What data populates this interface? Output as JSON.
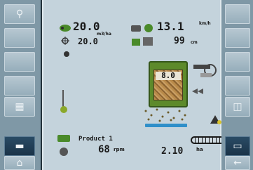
{
  "seed_rate": {
    "value": "20.0",
    "target": "20.0",
    "unit": "m3/ha"
  },
  "speed": {
    "value": "13.1",
    "unit": "km/h"
  },
  "depth": {
    "value": "99",
    "unit": "cm"
  },
  "hopper": {
    "value": "8.0"
  },
  "product": {
    "name": "Product 1",
    "rpm_value": "68",
    "rpm_unit": "rpm"
  },
  "area": {
    "value": "2.10",
    "unit": "ha"
  },
  "icons": {
    "left_top": "magnifier-icon",
    "left_mid": "calculator-icon",
    "left_bottom_1": "menu-icon",
    "left_bottom_2": "home-icon",
    "right_mid": "section-icon",
    "right_bottom_1": "screen-icon",
    "right_bottom_2": "back-arrow-icon"
  },
  "colors": {
    "screen_bg": "#c4d3dc",
    "hopper": "#5d8a2b",
    "progress": "#2f8fc9"
  }
}
